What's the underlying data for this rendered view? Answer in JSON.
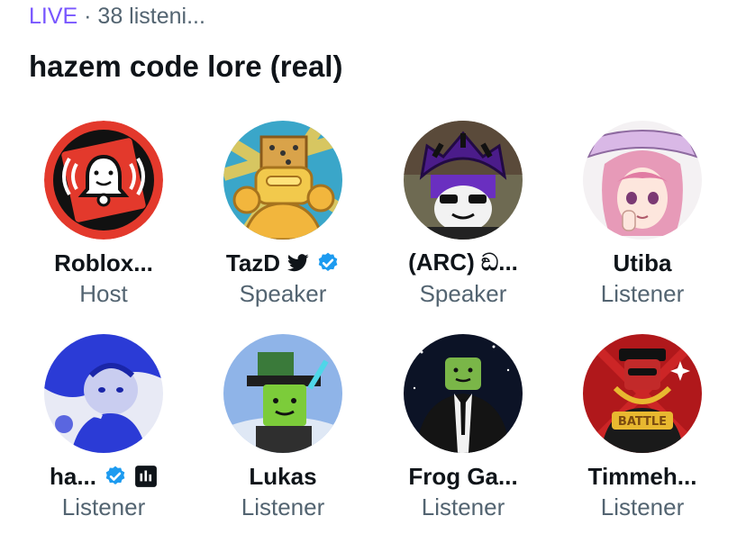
{
  "space": {
    "live_label": "LIVE",
    "separator": " · ",
    "listeners_label": "38 listeni..."
  },
  "title": "hazem code lore (real)",
  "participants": [
    {
      "name": "Roblox...",
      "role": "Host",
      "avatar": "roblox-bell-avatar"
    },
    {
      "name": "TazD",
      "role": "Speaker",
      "avatar": "golden-robot-avatar",
      "badges": [
        "bird-icon",
        "verified-icon"
      ]
    },
    {
      "name": "(ARC) ඞ...",
      "role": "Speaker",
      "avatar": "purple-hat-avatar"
    },
    {
      "name": "Utiba",
      "role": "Listener",
      "avatar": "pink-hair-anime-avatar"
    },
    {
      "name": "ha...",
      "role": "Listener",
      "avatar": "blue-cherub-avatar",
      "badges": [
        "verified-icon",
        "audio-bars-icon"
      ]
    },
    {
      "name": "Lukas",
      "role": "Listener",
      "avatar": "green-roblox-avatar"
    },
    {
      "name": "Frog Ga...",
      "role": "Listener",
      "avatar": "suited-roblox-avatar"
    },
    {
      "name": "Timmeh...",
      "role": "Listener",
      "avatar": "battle-chain-avatar"
    }
  ],
  "colors": {
    "live": "#7856ff",
    "verified": "#1d9bf0",
    "secondary_text": "#536471"
  }
}
